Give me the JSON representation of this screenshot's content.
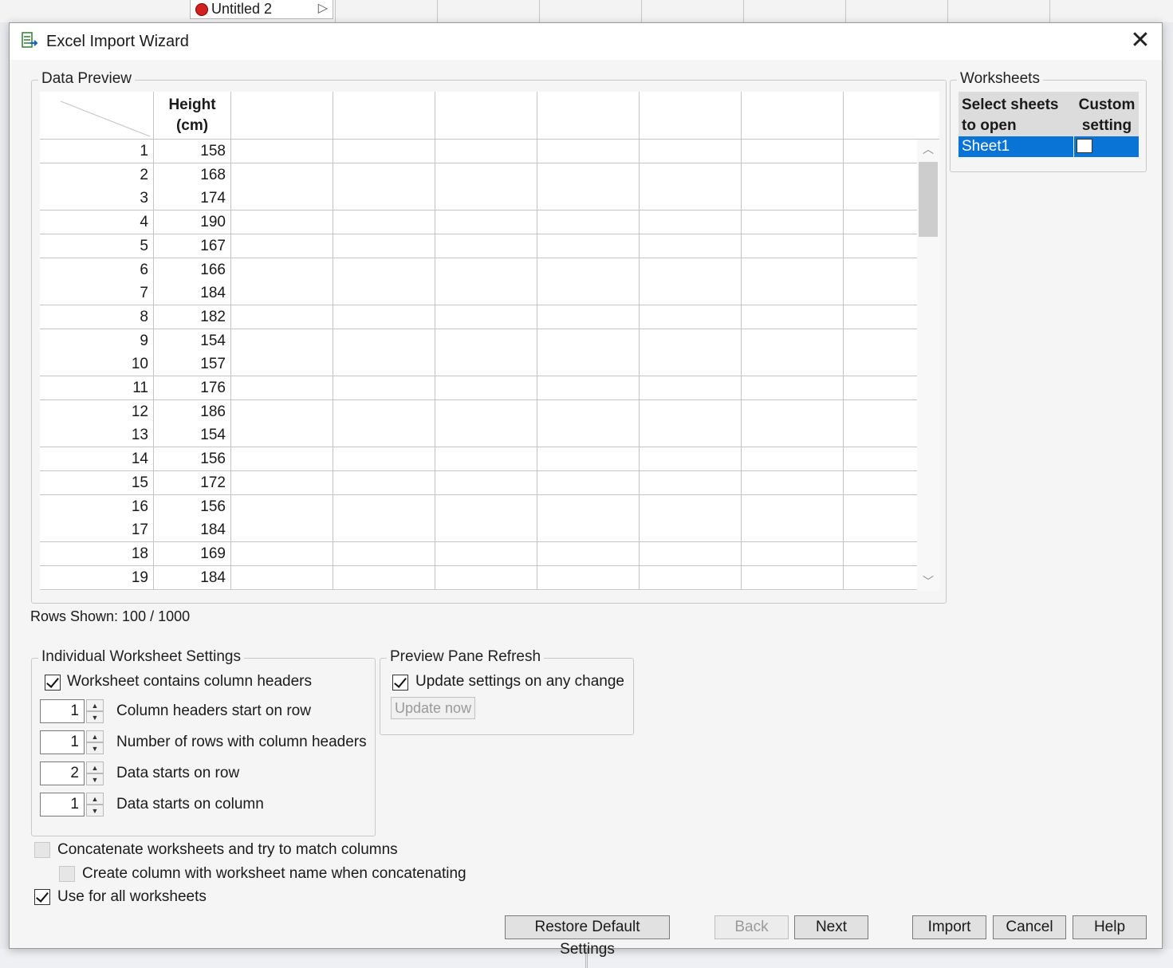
{
  "background": {
    "tab_label": "Untitled 2"
  },
  "dialog": {
    "title": "Excel Import Wizard"
  },
  "data_preview": {
    "group_title": "Data Preview",
    "columns": [
      "Height\n(cm)",
      "",
      "",
      "",
      "",
      "",
      ""
    ],
    "rows": [
      {
        "n": "1",
        "v": "158"
      },
      {
        "n": "2",
        "v": "168"
      },
      {
        "n": "3",
        "v": "174"
      },
      {
        "n": "4",
        "v": "190"
      },
      {
        "n": "5",
        "v": "167"
      },
      {
        "n": "6",
        "v": "166"
      },
      {
        "n": "7",
        "v": "184"
      },
      {
        "n": "8",
        "v": "182"
      },
      {
        "n": "9",
        "v": "154"
      },
      {
        "n": "10",
        "v": "157"
      },
      {
        "n": "11",
        "v": "176"
      },
      {
        "n": "12",
        "v": "186"
      },
      {
        "n": "13",
        "v": "154"
      },
      {
        "n": "14",
        "v": "156"
      },
      {
        "n": "15",
        "v": "172"
      },
      {
        "n": "16",
        "v": "156"
      },
      {
        "n": "17",
        "v": "184"
      },
      {
        "n": "18",
        "v": "169"
      },
      {
        "n": "19",
        "v": "184"
      }
    ],
    "rows_shown": "Rows Shown: 100 / 1000"
  },
  "worksheets": {
    "group_title": "Worksheets",
    "col_select": "Select sheets to open",
    "col_custom": "Custom setting",
    "sheets": [
      {
        "name": "Sheet1",
        "selected": true,
        "custom": false
      }
    ]
  },
  "individual_settings": {
    "group_title": "Individual Worksheet Settings",
    "contains_headers_label": "Worksheet contains column headers",
    "contains_headers_checked": true,
    "headers_start_value": "1",
    "headers_start_label": "Column headers start on row",
    "header_rows_value": "1",
    "header_rows_label": "Number of rows with column headers",
    "data_row_value": "2",
    "data_row_label": "Data starts on row",
    "data_col_value": "1",
    "data_col_label": "Data starts on column"
  },
  "preview_refresh": {
    "group_title": "Preview Pane Refresh",
    "update_any_label": "Update settings on any change",
    "update_any_checked": true,
    "update_now_label": "Update now"
  },
  "options": {
    "concatenate_label": "Concatenate worksheets and try to match columns",
    "create_column_label": "Create column with worksheet name when concatenating",
    "use_all_label": "Use for all worksheets",
    "use_all_checked": true
  },
  "buttons": {
    "restore": "Restore Default Settings",
    "back": "Back",
    "next": "Next",
    "import": "Import",
    "cancel": "Cancel",
    "help": "Help"
  }
}
